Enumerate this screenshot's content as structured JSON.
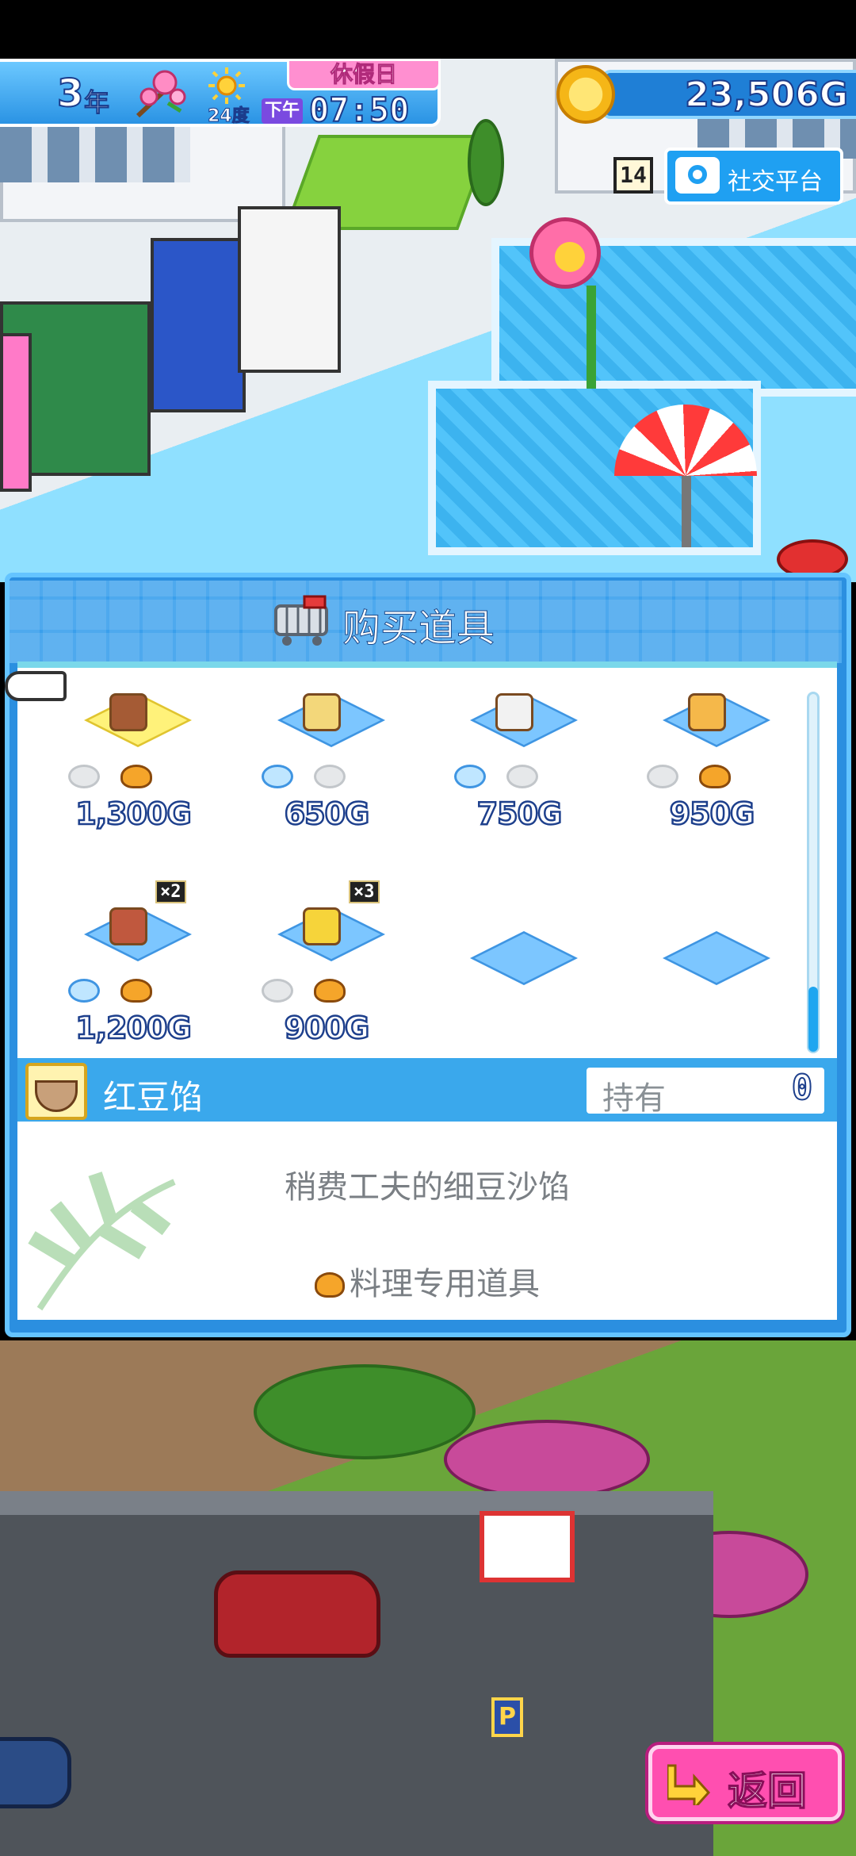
{
  "hud": {
    "year_number": "3",
    "year_unit": "年",
    "temperature": "24度",
    "holiday_label": "休假日",
    "ampm": "下午",
    "clock": "07:50",
    "gold": "23,506G",
    "notification_count": "14",
    "social_label": "社交平台"
  },
  "dialog": {
    "title": "购买道具",
    "items": [
      {
        "price": "1,300G",
        "attrs": [
          "off",
          "food"
        ],
        "multiplier": "",
        "selected": true,
        "art_color": "#a55b35"
      },
      {
        "price": "650G",
        "attrs": [
          "water",
          "off"
        ],
        "multiplier": "",
        "selected": false,
        "art_color": "#f3d77a"
      },
      {
        "price": "750G",
        "attrs": [
          "water",
          "off"
        ],
        "multiplier": "",
        "selected": false,
        "art_color": "#f2f2f2"
      },
      {
        "price": "950G",
        "attrs": [
          "off",
          "food"
        ],
        "multiplier": "",
        "selected": false,
        "art_color": "#f5b84a"
      },
      {
        "price": "1,200G",
        "attrs": [
          "water",
          "food"
        ],
        "multiplier": "×2",
        "selected": false,
        "art_color": "#c0583e"
      },
      {
        "price": "900G",
        "attrs": [
          "off",
          "food"
        ],
        "multiplier": "×3",
        "selected": false,
        "art_color": "#f6d43a"
      },
      {
        "price": "",
        "attrs": [],
        "multiplier": "",
        "selected": false,
        "art_color": ""
      },
      {
        "price": "",
        "attrs": [],
        "multiplier": "",
        "selected": false,
        "art_color": ""
      }
    ],
    "selected_item": {
      "name": "红豆馅",
      "owned_label": "持有",
      "owned_value": "0",
      "description": "稍费工夫的细豆沙馅",
      "tag": "料理专用道具"
    },
    "scroll_position": 0.82
  },
  "back_label": "返回",
  "colors": {
    "dialog_blue": "#2b8fe0",
    "price_outline": "#1d3f8c",
    "back_pink": "#ff4fb0",
    "selected_slot": "#fff27a"
  }
}
